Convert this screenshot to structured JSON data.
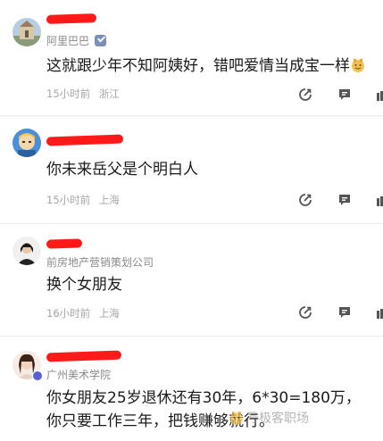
{
  "comments": [
    {
      "org": "阿里巴巴",
      "verified": true,
      "content": "这就跟少年不知阿姨好，错吧爱情当成宝一样",
      "time": "15小时前",
      "location": "浙江"
    },
    {
      "org": "",
      "verified": false,
      "content": "你未来岳父是个明白人",
      "time": "15小时前",
      "location": "上海"
    },
    {
      "org": "前房地产营销策划公司",
      "verified": false,
      "content": "换个女朋友",
      "time": "16小时前",
      "location": "上海"
    },
    {
      "org": "广州美术学院",
      "verified": false,
      "content_line1": "你女朋友25岁退休还有30年，6*30=180万，",
      "content_line2": "你只要工作三年，把钱赚够就行。"
    }
  ],
  "watermark": "号极客职场",
  "colors": {
    "redaction": "#ff1a1a",
    "meta": "#a5a5a5",
    "org": "#8a8a8a",
    "icon": "#555555",
    "badge": "#5a5fd6"
  },
  "icons": [
    "share-icon",
    "comment-icon",
    "like-icon",
    "verified-icon",
    "emoji-icon"
  ]
}
